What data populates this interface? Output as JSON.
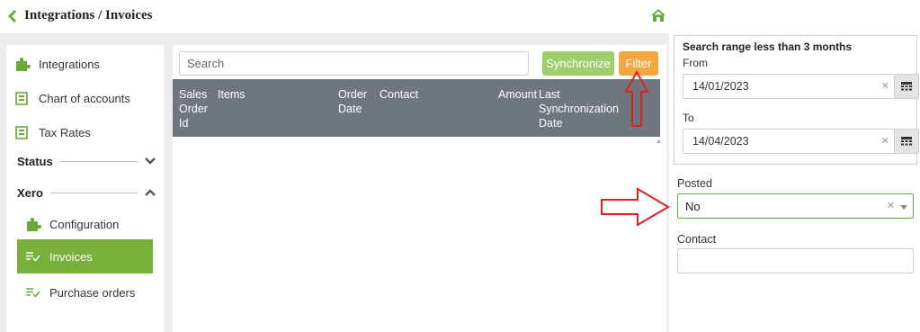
{
  "header": {
    "title": "Integrations / Invoices"
  },
  "sidebar": {
    "items": [
      {
        "label": "Integrations"
      },
      {
        "label": "Chart of accounts"
      },
      {
        "label": "Tax Rates"
      }
    ],
    "sections": [
      {
        "label": "Status",
        "state": "collapsed"
      },
      {
        "label": "Xero",
        "state": "expanded"
      }
    ],
    "xero_items": [
      {
        "label": "Configuration"
      },
      {
        "label": "Invoices",
        "active": true
      },
      {
        "label": "Purchase orders"
      }
    ]
  },
  "toolbar": {
    "search_placeholder": "Search",
    "sync_label": "Synchronize",
    "filter_label": "Filter"
  },
  "table": {
    "columns": [
      [
        "Sales",
        "Order",
        "Id"
      ],
      [
        "Items"
      ],
      [
        "Order",
        "Date"
      ],
      [
        "Contact"
      ],
      [
        "Amount"
      ],
      [
        "Last",
        "Synchronization",
        "Date"
      ]
    ],
    "rows": []
  },
  "filters": {
    "range_title": "Search range less than 3 months",
    "from_label": "From",
    "from_value": "14/01/2023",
    "to_label": "To",
    "to_value": "14/04/2023",
    "posted_label": "Posted",
    "posted_value": "No",
    "contact_label": "Contact",
    "contact_value": ""
  },
  "colors": {
    "accent_green": "#77b13a",
    "sync_button": "#9fcf6c",
    "filter_button": "#f3a73f",
    "table_header": "#6f767d",
    "annotation_red": "#e02020"
  }
}
